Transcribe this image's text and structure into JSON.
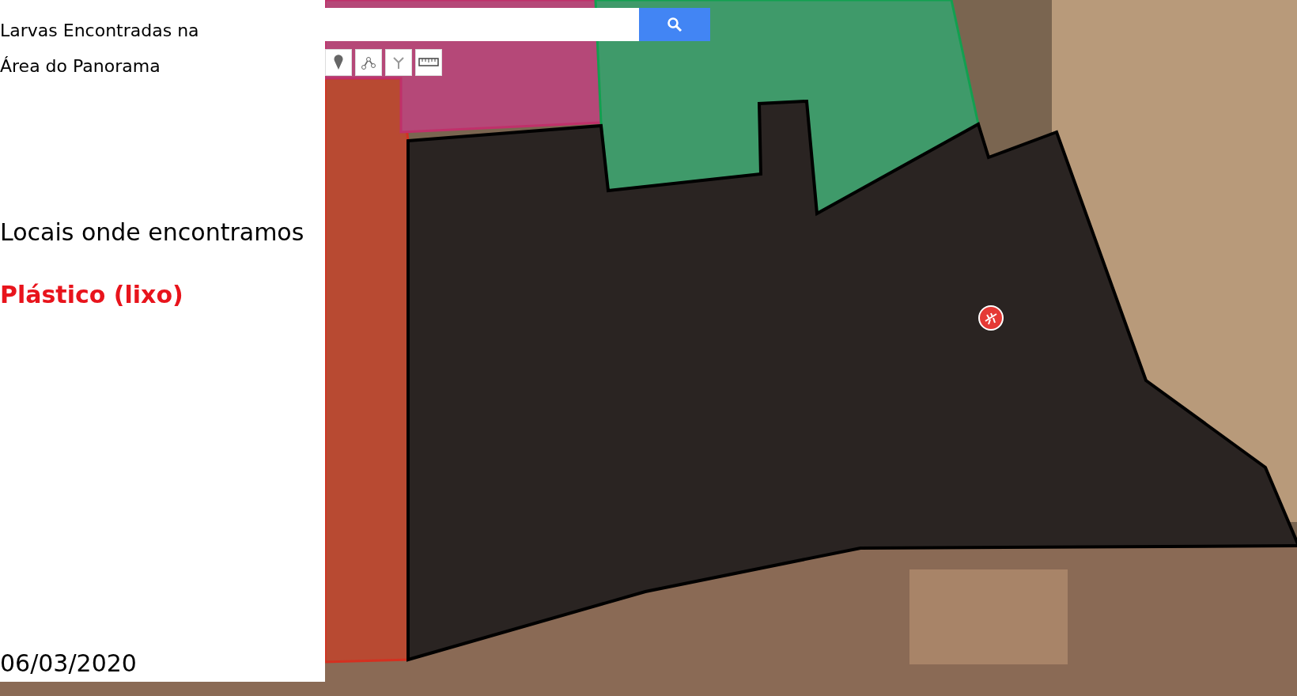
{
  "panel": {
    "title": "Larvas Encontradas na Área do Panorama",
    "subtitle": "Locais onde encontramos",
    "highlight": "Plástico (lixo)",
    "date": "06/03/2020"
  }
}
